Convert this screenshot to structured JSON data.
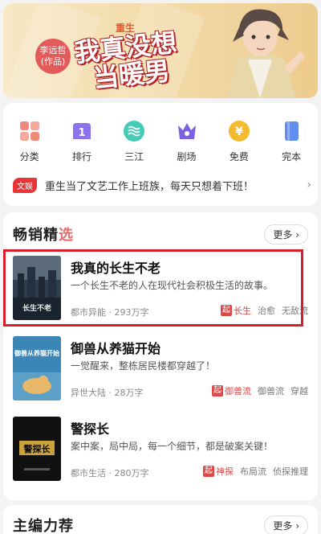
{
  "banner": {
    "tag": "重生",
    "author": "李远哲",
    "author_suffix": "(作品)",
    "title_line1": "我真没想",
    "title_line2": "当暖男"
  },
  "quick_nav": [
    {
      "label": "分类",
      "icon": "grid-icon",
      "color": "#f07c6c"
    },
    {
      "label": "排行",
      "icon": "ranking-icon",
      "color": "#8a6cf0"
    },
    {
      "label": "三江",
      "icon": "waves-icon",
      "color": "#3fc8b3"
    },
    {
      "label": "剧场",
      "icon": "crown-icon",
      "color": "#7b5fe0"
    },
    {
      "label": "免费",
      "icon": "yen-icon",
      "color": "#f3b72c"
    },
    {
      "label": "完本",
      "icon": "book-icon",
      "color": "#5b8df0"
    }
  ],
  "notice": {
    "badge": "文娱",
    "text": "重生当了文艺工作上班族，每天只想着下班！",
    "arrow": "›"
  },
  "bestsellers": {
    "title_a": "畅销精",
    "title_b": "选",
    "more": "更多 ›",
    "books": [
      {
        "title": "我真的长生不老",
        "desc": "一个长生不老的人在现代社会积极生活的故事。",
        "meta": "都市异能 · 293万字",
        "tag_main": "长生",
        "tags": [
          "治愈",
          "无敌流"
        ],
        "cover_text": "长生不老",
        "cover_color": "#3a4a5a"
      },
      {
        "title": "御兽从养猫开始",
        "desc": "一觉醒来，整栋居民楼都穿越了！",
        "meta": "异世大陆 · 28万字",
        "tag_main": "御兽流",
        "tags": [
          "御兽流",
          "穿越"
        ],
        "cover_text": "御兽从养猫开始",
        "cover_color": "#3b7fa8"
      },
      {
        "title": "警探长",
        "desc": "案中案，局中局，每一个细节，都是破案关键！",
        "meta": "都市生活 · 280万字",
        "tag_main": "神探",
        "tags": [
          "布局流",
          "侦探推理"
        ],
        "cover_text": "警探长",
        "cover_color": "#111111"
      }
    ]
  },
  "editor": {
    "title": "主编力荐",
    "more": "更多 ›"
  }
}
